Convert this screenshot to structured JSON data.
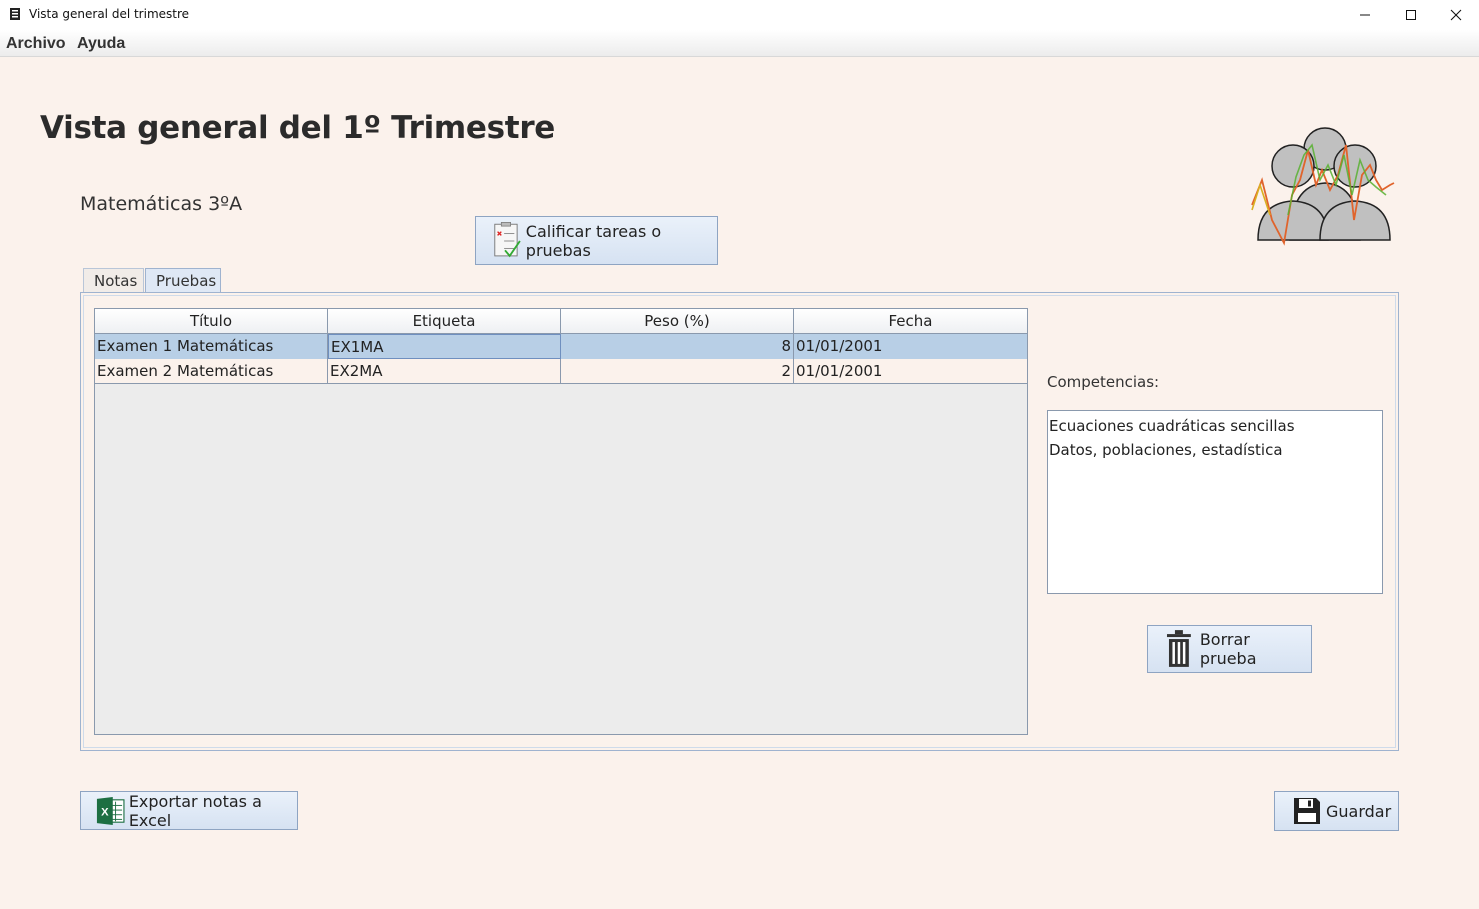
{
  "window": {
    "title": "Vista general del trimestre",
    "minimize_icon": "minimize-icon",
    "maximize_icon": "maximize-icon",
    "close_icon": "close-icon"
  },
  "menu": {
    "items": [
      "Archivo",
      "Ayuda"
    ]
  },
  "header": {
    "title": "Vista general del 1º Trimestre",
    "subject": "Matemáticas 3ºA"
  },
  "buttons": {
    "grade": "Calificar tareas o pruebas",
    "delete": "Borrar prueba",
    "export": "Exportar notas a Excel",
    "save": "Guardar"
  },
  "tabs": [
    {
      "label": "Notas",
      "selected": false
    },
    {
      "label": "Pruebas",
      "selected": true
    }
  ],
  "table": {
    "columns": [
      "Título",
      "Etiqueta",
      "Peso (%)",
      "Fecha"
    ],
    "rows": [
      {
        "titulo": "Examen 1 Matemáticas",
        "etiqueta": "EX1MA",
        "peso": "8",
        "fecha": "01/01/2001",
        "selected": true
      },
      {
        "titulo": "Examen 2 Matemáticas",
        "etiqueta": "EX2MA",
        "peso": "2",
        "fecha": "01/01/2001",
        "selected": false
      }
    ]
  },
  "competencias": {
    "label": "Competencias:",
    "items": [
      "Ecuaciones cuadráticas sencillas",
      "Datos, poblaciones, estadística"
    ]
  },
  "colors": {
    "background": "#fbf2ec",
    "selected_row": "#b8cfe6",
    "button_border": "#8ea4c2"
  }
}
